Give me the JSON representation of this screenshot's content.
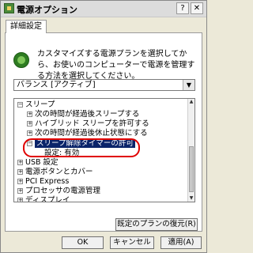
{
  "window": {
    "title": "電源オプション",
    "help_glyph": "?",
    "close_glyph": "✕"
  },
  "tabs": [
    {
      "label": "詳細設定"
    }
  ],
  "description": "カスタマイズする電源プランを選択してから、お使いのコンピューターで電源を管理する方法を選択してください。",
  "plan_select": {
    "value": "バランス [アクティブ]"
  },
  "tree": {
    "items": [
      {
        "label": "スリープ",
        "toggle": "−"
      },
      {
        "label": "次の時間が経過後スリープする",
        "toggle": "+"
      },
      {
        "label": "ハイブリッド スリープを許可する",
        "toggle": "+"
      },
      {
        "label": "次の時間が経過後休止状態にする",
        "toggle": "+"
      },
      {
        "label": "スリープ解除タイマーの許可",
        "toggle": "−"
      },
      {
        "label": "設定: 有効"
      },
      {
        "label": "USB 設定",
        "toggle": "+"
      },
      {
        "label": "電源ボタンとカバー",
        "toggle": "+"
      },
      {
        "label": "PCI Express",
        "toggle": "+"
      },
      {
        "label": "プロセッサの電源管理",
        "toggle": "+"
      },
      {
        "label": "ディスプレイ",
        "toggle": "+"
      }
    ]
  },
  "buttons": {
    "restore": "既定のプランの復元(R)",
    "ok": "OK",
    "cancel": "キャンセル",
    "apply": "適用(A)"
  },
  "colors": {
    "selection": "#0a246a",
    "highlight_ring": "#e00000",
    "icon_green": "#2e7c22"
  }
}
